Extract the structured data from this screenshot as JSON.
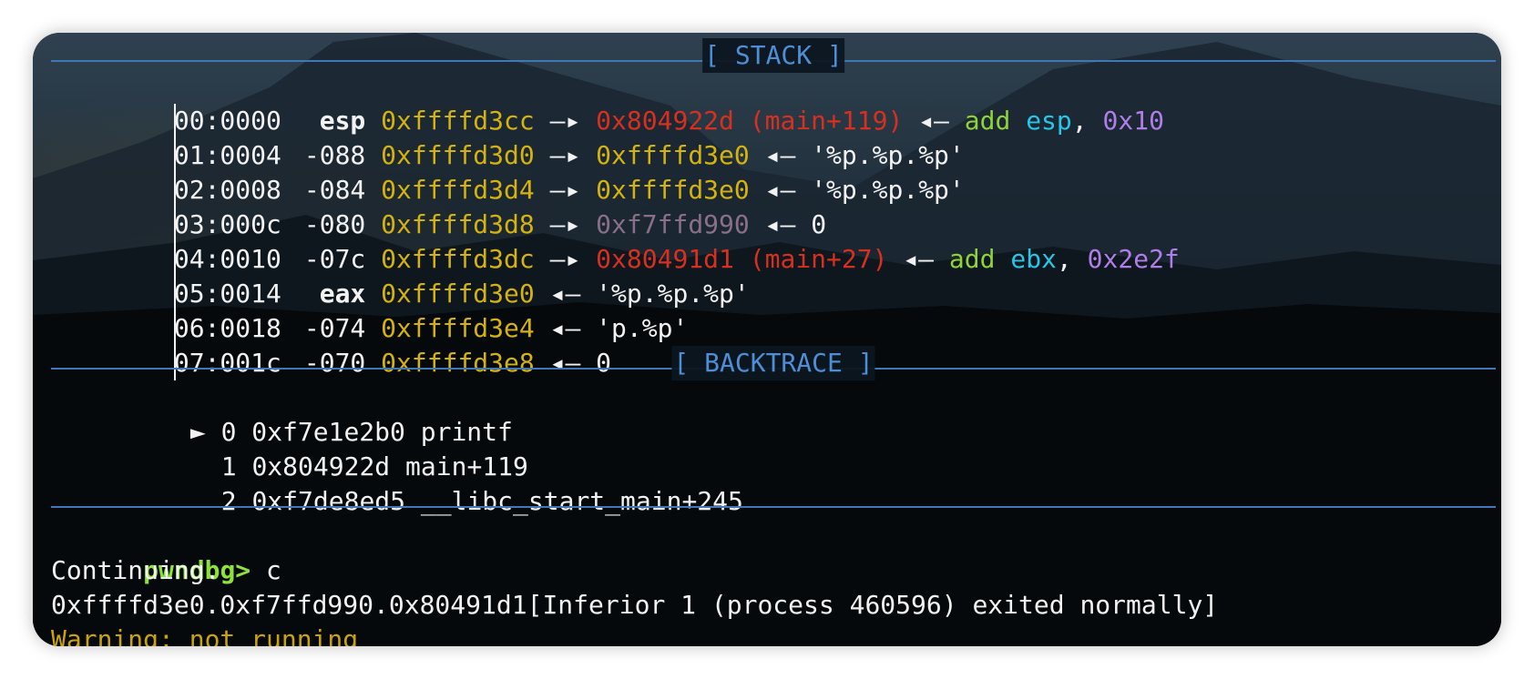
{
  "stack": {
    "title": "[ STACK ]",
    "rows": [
      {
        "idx": "00:0000",
        "reg": " esp",
        "addr": "0xffffd3cc",
        "arrow": "—▸",
        "target": "0x804922d (main+119)",
        "target_color": "red",
        "arrow2": "◂—",
        "rest_op": "add",
        "rest_reg": "esp",
        "rest_sep": ",",
        "rest_imm": "0x10",
        "rest_str": ""
      },
      {
        "idx": "01:0004",
        "reg": "-088",
        "addr": "0xffffd3d0",
        "arrow": "—▸",
        "target": "0xffffd3e0",
        "target_color": "yellow",
        "arrow2": "◂—",
        "rest_op": "",
        "rest_reg": "",
        "rest_sep": "",
        "rest_imm": "",
        "rest_str": "'%p.%p.%p'"
      },
      {
        "idx": "02:0008",
        "reg": "-084",
        "addr": "0xffffd3d4",
        "arrow": "—▸",
        "target": "0xffffd3e0",
        "target_color": "yellow",
        "arrow2": "◂—",
        "rest_op": "",
        "rest_reg": "",
        "rest_sep": "",
        "rest_imm": "",
        "rest_str": "'%p.%p.%p'"
      },
      {
        "idx": "03:000c",
        "reg": "-080",
        "addr": "0xffffd3d8",
        "arrow": "—▸",
        "target": "0xf7ffd990",
        "target_color": "grey",
        "arrow2": "◂—",
        "rest_op": "",
        "rest_reg": "",
        "rest_sep": "",
        "rest_imm": "",
        "rest_str": "0"
      },
      {
        "idx": "04:0010",
        "reg": "-07c",
        "addr": "0xffffd3dc",
        "arrow": "—▸",
        "target": "0x80491d1 (main+27)",
        "target_color": "red",
        "arrow2": "◂—",
        "rest_op": "add",
        "rest_reg": "ebx",
        "rest_sep": ",",
        "rest_imm": "0x2e2f",
        "rest_str": ""
      },
      {
        "idx": "05:0014",
        "reg": " eax",
        "addr": "0xffffd3e0",
        "arrow": "",
        "target": "",
        "target_color": "",
        "arrow2": "◂—",
        "rest_op": "",
        "rest_reg": "",
        "rest_sep": "",
        "rest_imm": "",
        "rest_str": "'%p.%p.%p'"
      },
      {
        "idx": "06:0018",
        "reg": "-074",
        "addr": "0xffffd3e4",
        "arrow": "",
        "target": "",
        "target_color": "",
        "arrow2": "◂—",
        "rest_op": "",
        "rest_reg": "",
        "rest_sep": "",
        "rest_imm": "",
        "rest_str": "'p.%p'"
      },
      {
        "idx": "07:001c",
        "reg": "-070",
        "addr": "0xffffd3e8",
        "arrow": "",
        "target": "",
        "target_color": "",
        "arrow2": "◂—",
        "rest_op": "",
        "rest_reg": "",
        "rest_sep": "",
        "rest_imm": "",
        "rest_str": "0"
      }
    ]
  },
  "backtrace": {
    "title": "[ BACKTRACE ]",
    "frames": [
      {
        "marker": "►",
        "num": "0",
        "addr": "0xf7e1e2b0",
        "sym": "printf"
      },
      {
        "marker": "",
        "num": "1",
        "addr": "0x804922d",
        "sym": "main+119"
      },
      {
        "marker": "",
        "num": "2",
        "addr": "0xf7de8ed5",
        "sym": "__libc_start_main+245"
      }
    ]
  },
  "console": {
    "prompt": "pwndbg>",
    "command": " c",
    "line1": "Continuing.",
    "line2": "0xffffd3e0.0xf7ffd990.0x80491d1[Inferior 1 (process 460596) exited normally]",
    "line3": "Warning: not running"
  },
  "colors": {
    "border_blue": "#3f78b8",
    "title_blue": "#4f8ed4",
    "address_yellow": "#d4b20f",
    "code_red": "#d7301f",
    "mnemonic_green": "#8fd23a",
    "register_cyan": "#26c6e6",
    "immediate_purple": "#b07ee8",
    "prompt_green": "#8fe23a"
  }
}
